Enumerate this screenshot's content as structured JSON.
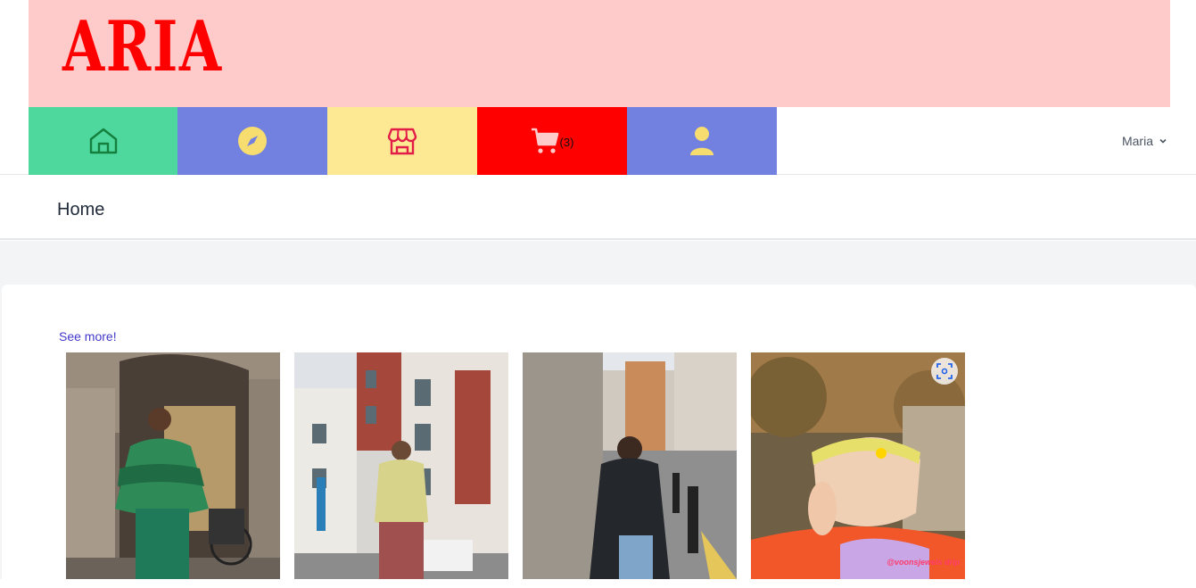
{
  "brand": {
    "logo_text": "ARIA"
  },
  "nav": {
    "tiles": [
      {
        "icon": "home-icon",
        "color": "#4ed89d"
      },
      {
        "icon": "compass-icon",
        "color": "#7281e0"
      },
      {
        "icon": "store-icon",
        "color": "#fde994"
      },
      {
        "icon": "cart-icon",
        "color": "#ff0000",
        "badge": "(3)"
      },
      {
        "icon": "user-icon",
        "color": "#7281e0"
      }
    ],
    "user_name": "Maria"
  },
  "header": {
    "title": "Home"
  },
  "gallery": {
    "see_more": "See more!",
    "photos": [
      {
        "alt": "street-style-green-sweater"
      },
      {
        "alt": "street-style-yellow-cardigan"
      },
      {
        "alt": "street-style-black-coat"
      },
      {
        "alt": "street-style-orange-sweater",
        "watermark": "@voonsjewels drip"
      }
    ]
  }
}
